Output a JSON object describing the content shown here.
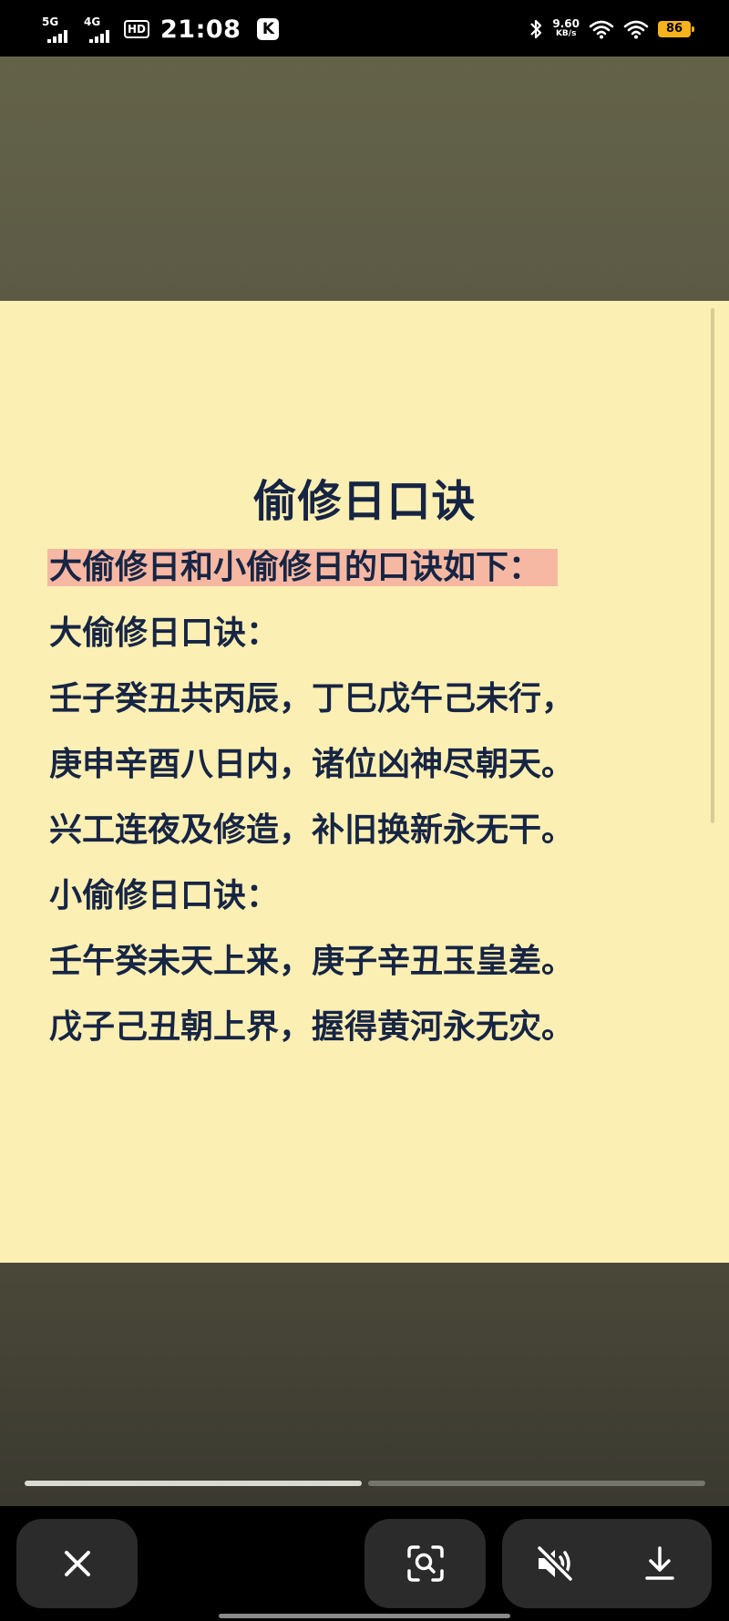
{
  "status_bar": {
    "network_1": "5G",
    "network_2": "4G",
    "hd_label": "HD",
    "time": "21:08",
    "app_badge": "K",
    "speed_value": "9.60",
    "speed_unit": "KB/s",
    "battery": "86"
  },
  "document": {
    "title": "偷修日口诀",
    "lines": [
      "大偷修日和小偷修日的口诀如下：",
      "大偷修日口诀：",
      "壬子癸丑共丙辰，丁巳戊午己未行，",
      "庚申辛酉八日内，诸位凶神尽朝天。",
      "兴工连夜及修造，补旧换新永无干。",
      "小偷修日口诀：",
      "壬午癸未天上来，庚子辛丑玉皇差。",
      "戊子己丑朝上界，握得黄河永无灾。"
    ]
  },
  "progress": {
    "segments": 2,
    "active_segment": 1
  },
  "toolbar": {
    "close_icon": "close-icon",
    "lens_icon": "image-search-icon",
    "mute_icon": "speaker-muted-icon",
    "download_icon": "download-icon"
  },
  "colors": {
    "card_background": "#fcefb3",
    "text": "#172544",
    "highlight": "#f6b8a3",
    "battery": "#f5b21c"
  }
}
